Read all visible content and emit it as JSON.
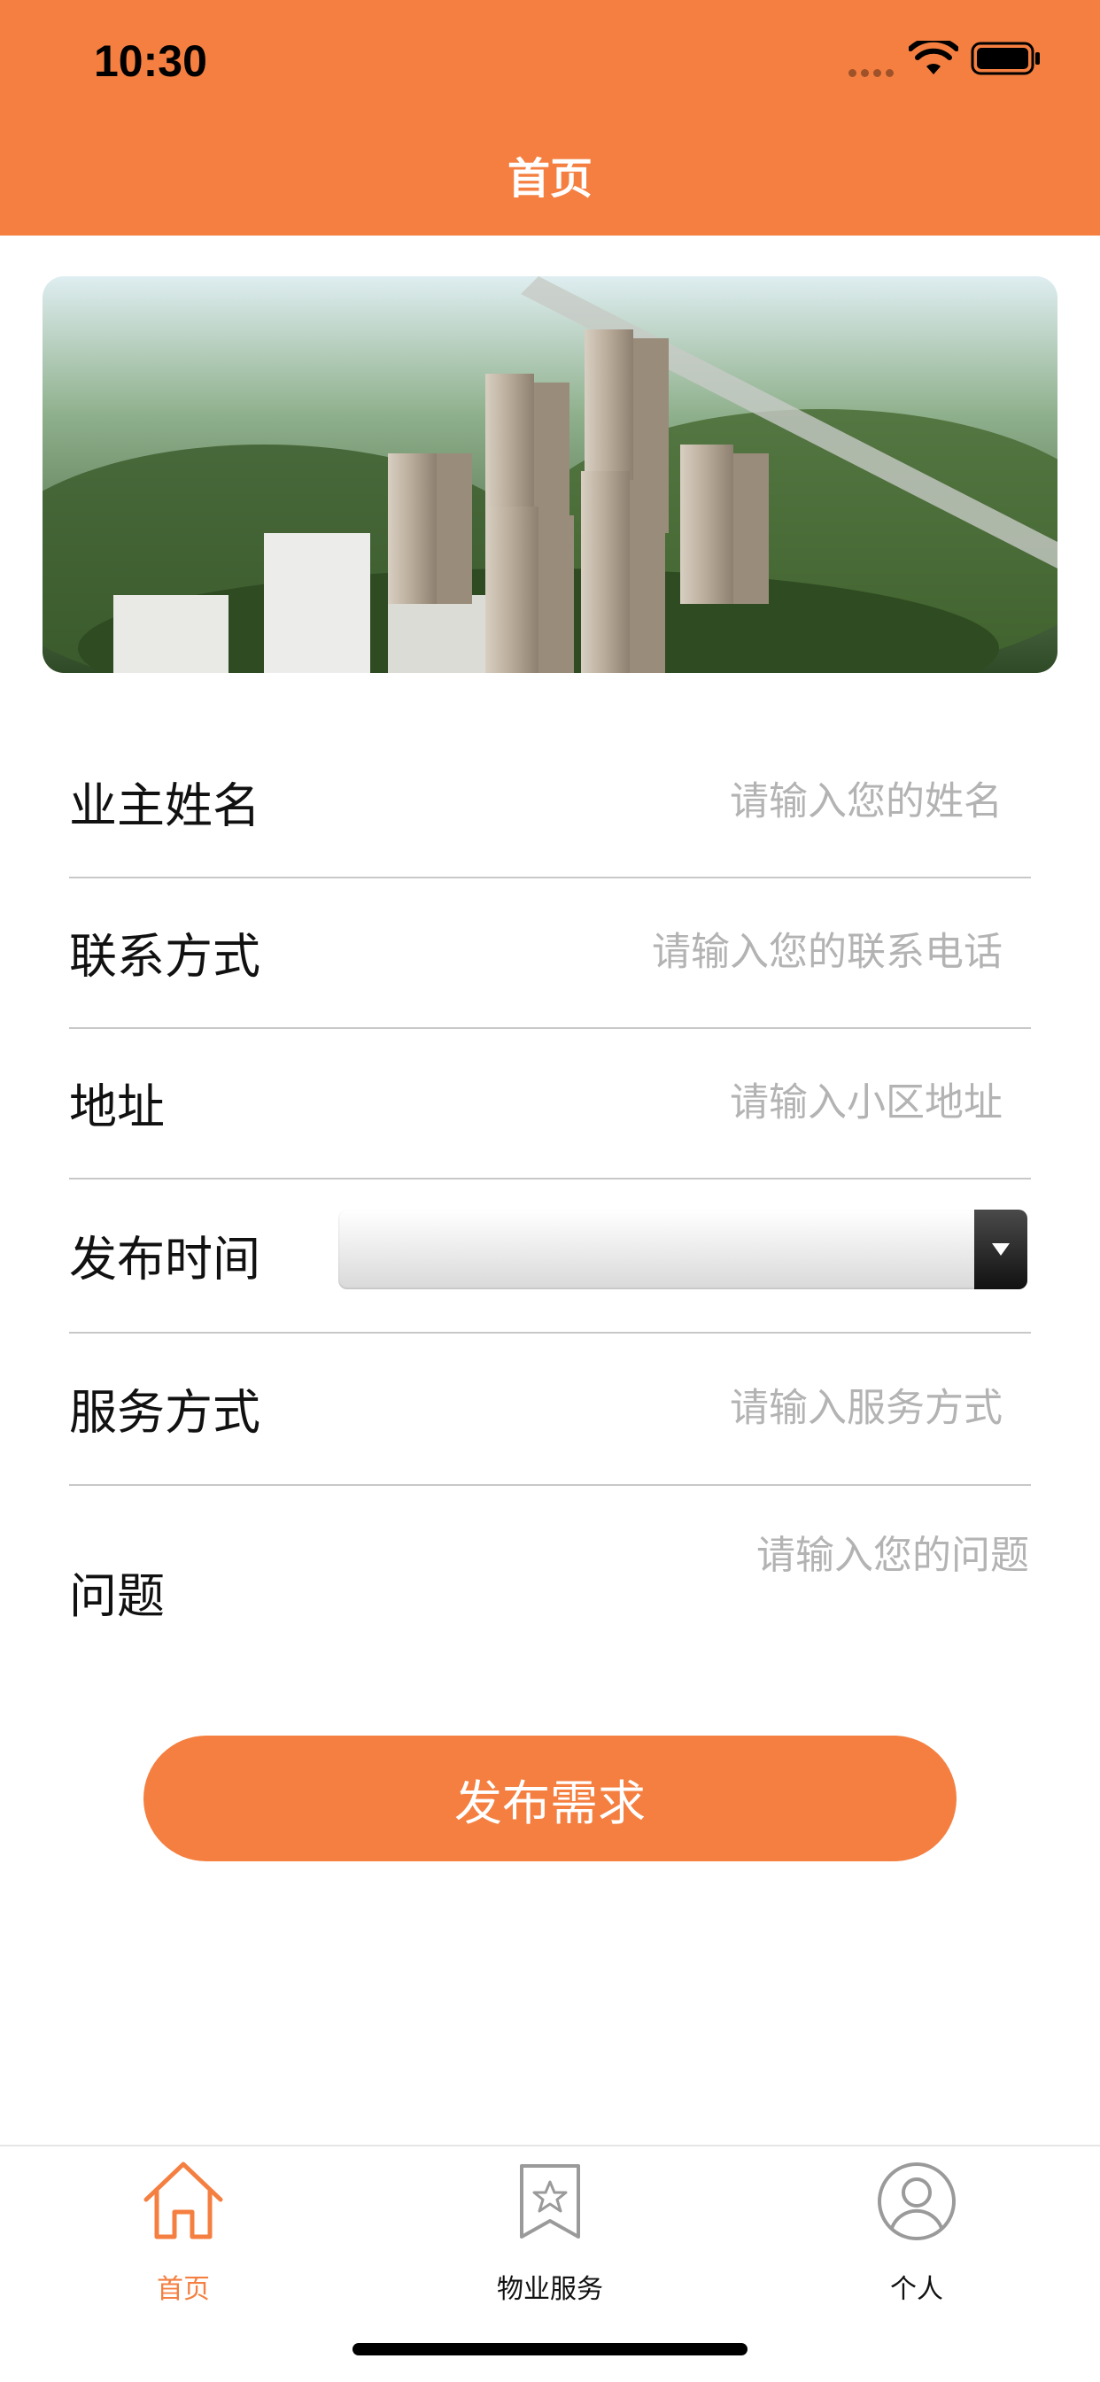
{
  "status_bar": {
    "time": "10:30"
  },
  "nav": {
    "title": "首页"
  },
  "banner": {
    "image": "residential-towers-aerial-photo"
  },
  "form": {
    "fields": [
      {
        "label": "业主姓名",
        "placeholder": "请输入您的姓名",
        "value": ""
      },
      {
        "label": "联系方式",
        "placeholder": "请输入您的联系电话",
        "value": ""
      },
      {
        "label": "地址",
        "placeholder": "请输入小区地址",
        "value": ""
      }
    ],
    "publish_time": {
      "label": "发布时间",
      "value": ""
    },
    "service": {
      "label": "服务方式",
      "placeholder": "请输入服务方式",
      "value": ""
    },
    "question": {
      "label": "问题",
      "placeholder": "请输入您的问题",
      "value": ""
    }
  },
  "submit": {
    "label": "发布需求"
  },
  "tabbar": {
    "tabs": [
      {
        "label": "首页",
        "icon": "home-icon",
        "active": true
      },
      {
        "label": "物业服务",
        "icon": "bookmark-star-icon",
        "active": false
      },
      {
        "label": "个人",
        "icon": "user-icon",
        "active": false
      }
    ]
  },
  "colors": {
    "accent": "#F47F40"
  }
}
